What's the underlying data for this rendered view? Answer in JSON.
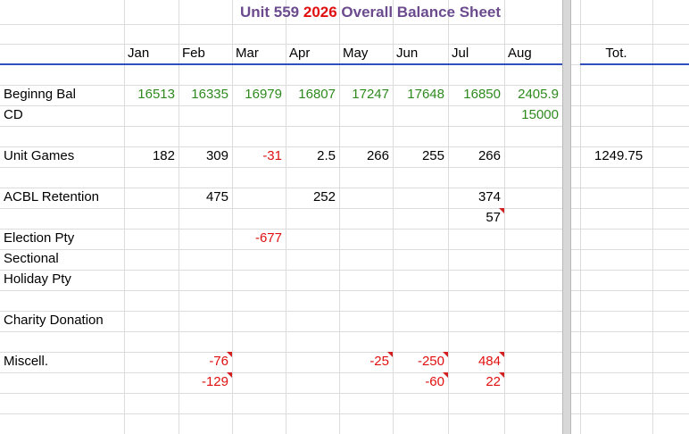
{
  "title": {
    "unit": "Unit 559",
    "year": "2026",
    "rest": "Overall Balance Sheet"
  },
  "months": [
    "Jan",
    "Feb",
    "Mar",
    "Apr",
    "May",
    "Jun",
    "Jul",
    "Aug"
  ],
  "total_header": "Tot.",
  "rows": {
    "beginning_bal": {
      "label": "Beginng Bal",
      "values": [
        "16513",
        "16335",
        "16979",
        "16807",
        "17247",
        "17648",
        "16850",
        "2405.9"
      ]
    },
    "cd": {
      "label": "CD",
      "aug": "15000"
    },
    "unit_games": {
      "label": "Unit Games",
      "jan": "182",
      "feb": "309",
      "mar": "-31",
      "apr": "2.5",
      "may": "266",
      "jun": "255",
      "jul": "266",
      "total": "1249.75"
    },
    "acbl_retention": {
      "label": "ACBL Retention",
      "feb": "475",
      "apr": "252",
      "jul": "374",
      "jul_2": "57"
    },
    "election_pty": {
      "label": "Election Pty",
      "mar": "-677"
    },
    "sectional": {
      "label": "Sectional"
    },
    "holiday_pty": {
      "label": "Holiday Pty"
    },
    "charity_donation": {
      "label": "Charity Donation"
    },
    "miscell": {
      "label": "Miscell.",
      "feb": "-76",
      "feb_2": "-129",
      "may": "-25",
      "jun": "-250",
      "jun_2": "-60",
      "jul": "484",
      "jul_2": "22"
    }
  },
  "colors": {
    "title": "#6b4a8e",
    "year": "#e01010",
    "green": "#2e8a1e",
    "red": "#e01010",
    "header_line": "#2f4fbf"
  }
}
